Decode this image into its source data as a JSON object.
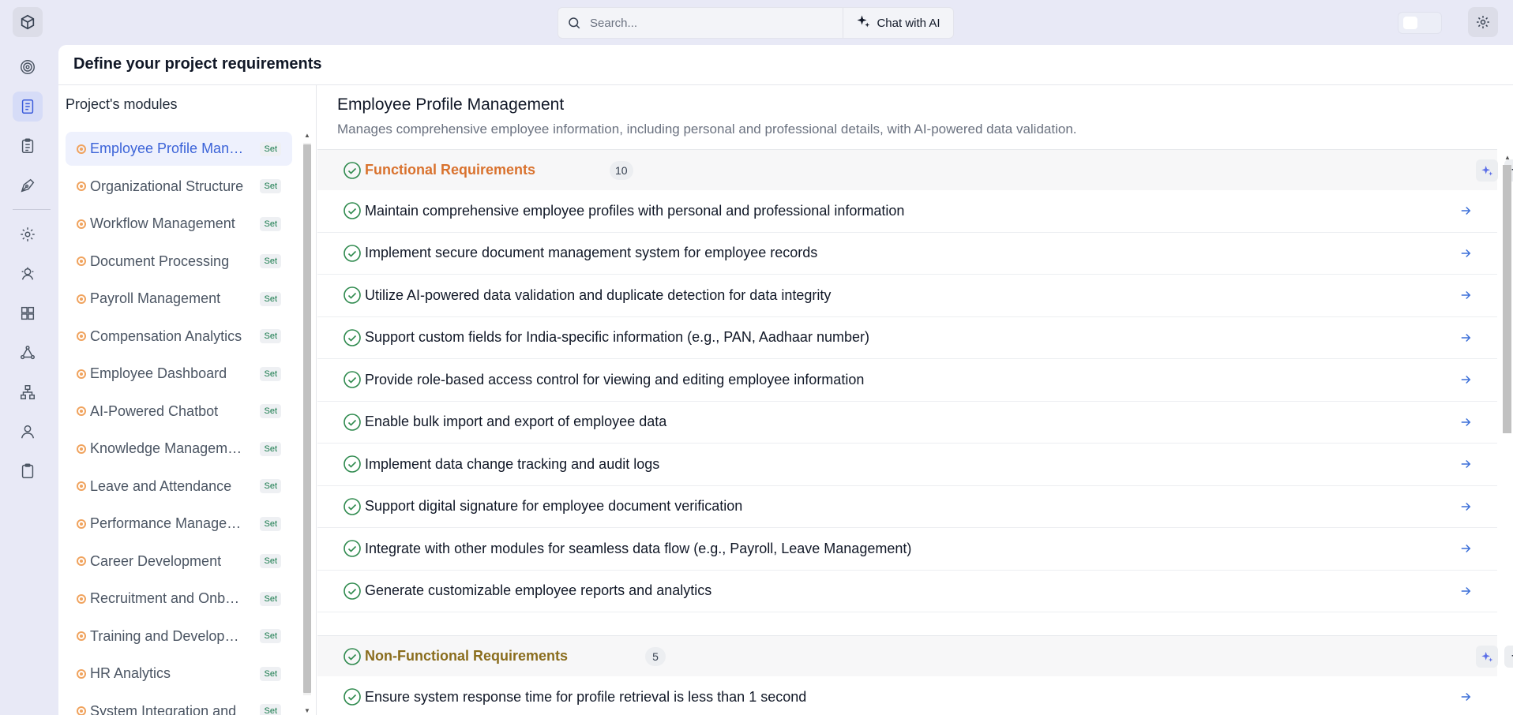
{
  "search": {
    "placeholder": "Search..."
  },
  "chat": {
    "label": "Chat with AI"
  },
  "page": {
    "title": "Define your project requirements"
  },
  "modules": {
    "title": "Project's modules",
    "badge": "Set",
    "items": [
      "Employee Profile Management",
      "Organizational Structure",
      "Workflow Management",
      "Document Processing",
      "Payroll Management",
      "Compensation Analytics",
      "Employee Dashboard",
      "AI-Powered Chatbot",
      "Knowledge Management",
      "Leave and Attendance",
      "Performance Management",
      "Career Development",
      "Recruitment and Onboarding",
      "Training and Development",
      "HR Analytics",
      "System Integration and"
    ]
  },
  "content": {
    "heading": "Employee Profile Management",
    "description": "Manages comprehensive employee information, including personal and professional details, with AI-powered data validation.",
    "functional": {
      "title": "Functional Requirements",
      "count": "10",
      "color": "#d9722e",
      "items": [
        "Maintain comprehensive employee profiles with personal and professional information",
        "Implement secure document management system for employee records",
        "Utilize AI-powered data validation and duplicate detection for data integrity",
        "Support custom fields for India-specific information (e.g., PAN, Aadhaar number)",
        "Provide role-based access control for viewing and editing employee information",
        "Enable bulk import and export of employee data",
        "Implement data change tracking and audit logs",
        "Support digital signature for employee document verification",
        "Integrate with other modules for seamless data flow (e.g., Payroll, Leave Management)",
        "Generate customizable employee reports and analytics"
      ]
    },
    "nonfunctional": {
      "title": "Non-Functional Requirements",
      "count": "5",
      "color": "#8a6d1d",
      "items": [
        "Ensure system response time for profile retrieval is less than 1 second"
      ]
    }
  },
  "colors": {
    "accent": "#3b63d8",
    "check": "#2f8a4e",
    "module_dot": "#f0a35e"
  }
}
